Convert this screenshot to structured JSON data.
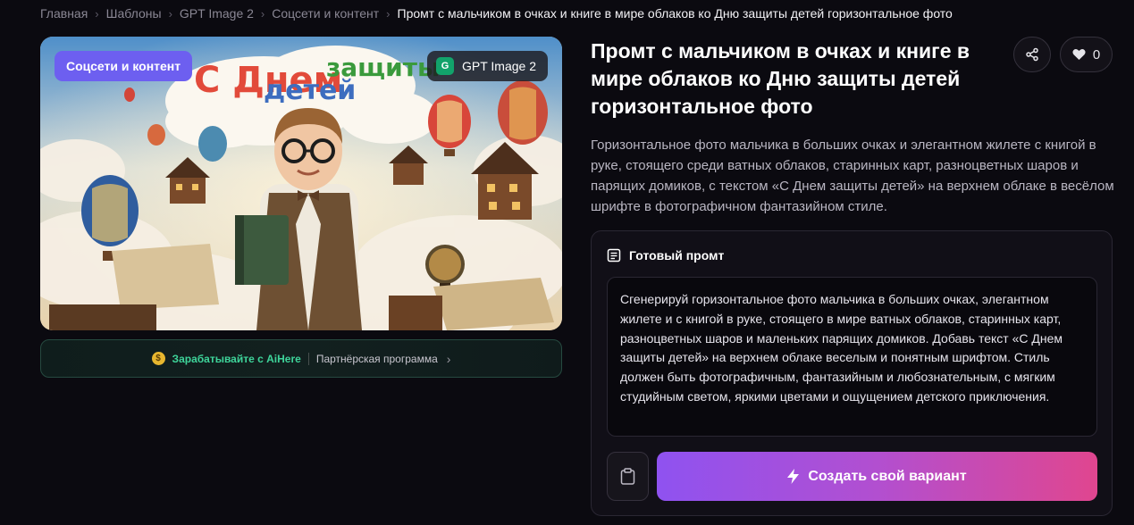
{
  "breadcrumb": {
    "items": [
      "Главная",
      "Шаблоны",
      "GPT Image 2",
      "Соцсети и контент"
    ],
    "current": "Промт с мальчиком в очках и книге в мире облаков ко Дню защиты детей горизонтальное фото"
  },
  "hero": {
    "category_chip": "Соцсети и контент",
    "model_badge_letter": "G",
    "model_chip": "GPT Image 2",
    "image_text_line1": "С Днем",
    "image_text_line2": "защиты",
    "image_text_line3": "детей"
  },
  "earn": {
    "icon": "coin-icon",
    "label": "Зарабатывайте с AiHere",
    "partner": "Партнёрская программа"
  },
  "header": {
    "title": "Промт с мальчиком в очках и книге в мире облаков ко Дню защиты детей горизонтальное фото",
    "likes": "0"
  },
  "description": "Горизонтальное фото мальчика в больших очках и элегантном жилете с книгой в руке, стоящего среди ватных облаков, старинных карт, разноцветных шаров и парящих домиков, с текстом «С Днем защиты детей» на верхнем облаке в весёлом шрифте в фотографичном фантазийном стиле.",
  "prompt": {
    "heading": "Готовый промт",
    "text": "Сгенерируй горизонтальное фото мальчика в больших очках, элегантном жилете и с книгой в руке, стоящего в мире ватных облаков, старинных карт, разноцветных шаров и маленьких парящих домиков. Добавь текст «С Днем защиты детей» на верхнем облаке веселым и понятным шрифтом. Стиль должен быть фотографичным, фантазийным и любознательным, с мягким студийным светом, яркими цветами и ощущением детского приключения.",
    "create_label": "Создать свой вариант"
  },
  "colors": {
    "accent": "#6d5ff0",
    "gradient_start": "#8f52f0",
    "gradient_end": "#e0468f",
    "earn_green": "#3ed49a"
  }
}
